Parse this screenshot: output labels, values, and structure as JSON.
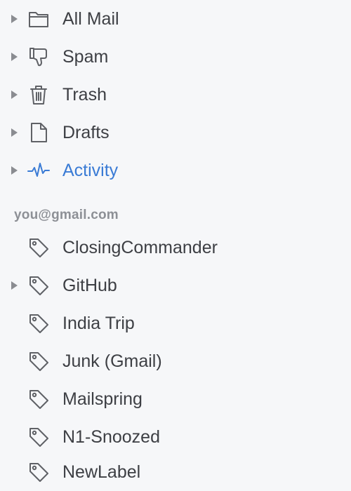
{
  "mailboxes": [
    {
      "label": "All Mail",
      "icon": "folder-icon",
      "expandable": true
    },
    {
      "label": "Spam",
      "icon": "thumbs-down-icon",
      "expandable": true
    },
    {
      "label": "Trash",
      "icon": "trash-icon",
      "expandable": true
    },
    {
      "label": "Drafts",
      "icon": "document-icon",
      "expandable": true
    },
    {
      "label": "Activity",
      "icon": "activity-icon",
      "expandable": true,
      "active": true
    }
  ],
  "account": {
    "email": "you@gmail.com"
  },
  "labels": [
    {
      "label": "ClosingCommander",
      "icon": "tag-icon",
      "expandable": false
    },
    {
      "label": "GitHub",
      "icon": "tag-icon",
      "expandable": true
    },
    {
      "label": "India Trip",
      "icon": "tag-icon",
      "expandable": false
    },
    {
      "label": "Junk (Gmail)",
      "icon": "tag-icon",
      "expandable": false
    },
    {
      "label": "Mailspring",
      "icon": "tag-icon",
      "expandable": false
    },
    {
      "label": "N1-Snoozed",
      "icon": "tag-icon",
      "expandable": false
    },
    {
      "label": "NewLabel",
      "icon": "tag-icon",
      "expandable": false
    }
  ],
  "colors": {
    "text": "#3d3f44",
    "active": "#3a7bd5",
    "section_header": "#8d9096",
    "icon": "#5f6166",
    "caret": "#8a8c91",
    "background": "#f6f7f9"
  }
}
